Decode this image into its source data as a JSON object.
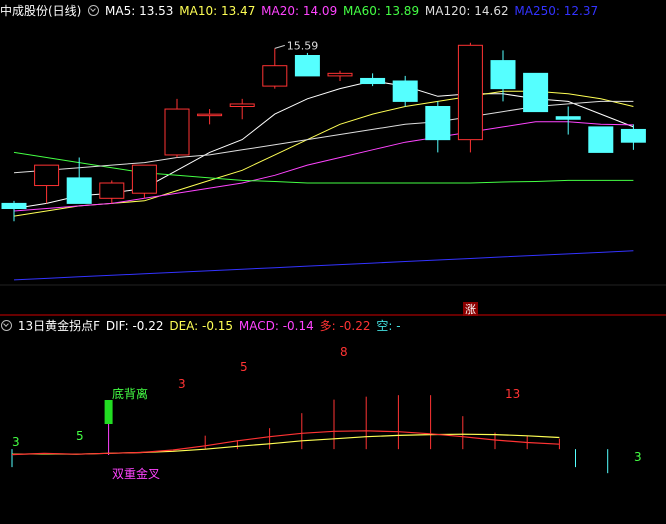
{
  "top_header": {
    "stock_name": "中成股份(日线)",
    "indicators": [
      {
        "label": "MA5: 13.53",
        "color": "#ffffff"
      },
      {
        "label": "MA10: 13.47",
        "color": "#ffff55"
      },
      {
        "label": "MA20: 14.09",
        "color": "#ff44ff"
      },
      {
        "label": "MA60: 13.89",
        "color": "#44ff44"
      },
      {
        "label": "MA120: 14.62",
        "color": "#dddddd"
      },
      {
        "label": "MA250: 12.37",
        "color": "#3333ff"
      }
    ]
  },
  "bottom_header": {
    "indicator_name": "13日黄金拐点F",
    "indicators": [
      {
        "label": "DIF: -0.22",
        "color": "#ffffff"
      },
      {
        "label": "DEA: -0.15",
        "color": "#ffff55"
      },
      {
        "label": "MACD: -0.14",
        "color": "#ff44ff"
      },
      {
        "label": "多: -0.22",
        "color": "#ff3333"
      },
      {
        "label": "空: -",
        "color": "#44dddd"
      }
    ]
  },
  "chart_data": [
    {
      "type": "candlestick",
      "high_label": "15.59",
      "marker": "涨",
      "candles": [
        {
          "o": 12.55,
          "h": 12.6,
          "l": 12.2,
          "c": 12.45
        },
        {
          "o": 12.9,
          "h": 13.15,
          "l": 12.55,
          "c": 13.3
        },
        {
          "o": 13.05,
          "h": 13.45,
          "l": 12.55,
          "c": 12.55
        },
        {
          "o": 12.65,
          "h": 13.0,
          "l": 12.55,
          "c": 12.95
        },
        {
          "o": 12.75,
          "h": 13.25,
          "l": 12.65,
          "c": 13.3
        },
        {
          "o": 13.5,
          "h": 14.6,
          "l": 13.45,
          "c": 14.4
        },
        {
          "o": 14.3,
          "h": 14.4,
          "l": 14.1,
          "c": 14.3
        },
        {
          "o": 14.45,
          "h": 14.6,
          "l": 14.2,
          "c": 14.5
        },
        {
          "o": 14.85,
          "h": 15.59,
          "l": 14.8,
          "c": 15.25
        },
        {
          "o": 15.45,
          "h": 15.5,
          "l": 15.05,
          "c": 15.05
        },
        {
          "o": 15.05,
          "h": 15.15,
          "l": 14.95,
          "c": 15.1
        },
        {
          "o": 15.0,
          "h": 15.1,
          "l": 14.85,
          "c": 14.9
        },
        {
          "o": 14.95,
          "h": 15.05,
          "l": 14.45,
          "c": 14.55
        },
        {
          "o": 14.45,
          "h": 14.55,
          "l": 13.55,
          "c": 13.8
        },
        {
          "o": 13.8,
          "h": 15.7,
          "l": 13.55,
          "c": 15.65
        },
        {
          "o": 15.35,
          "h": 15.55,
          "l": 14.55,
          "c": 14.8
        },
        {
          "o": 15.1,
          "h": 15.1,
          "l": 14.35,
          "c": 14.35
        },
        {
          "o": 14.25,
          "h": 14.45,
          "l": 13.9,
          "c": 14.2
        },
        {
          "o": 14.05,
          "h": 14.05,
          "l": 13.55,
          "c": 13.55
        },
        {
          "o": 14.0,
          "h": 14.1,
          "l": 13.6,
          "c": 13.75
        }
      ],
      "ma_series": [
        {
          "name": "MA5",
          "color": "#ffffff",
          "values": [
            12.45,
            12.55,
            12.7,
            12.75,
            12.85,
            13.2,
            13.55,
            13.8,
            14.3,
            14.6,
            14.8,
            14.95,
            14.85,
            14.65,
            14.7,
            14.7,
            14.6,
            14.55,
            14.3,
            14.05
          ]
        },
        {
          "name": "MA10",
          "color": "#ffff55",
          "values": [
            12.3,
            12.4,
            12.5,
            12.55,
            12.6,
            12.8,
            13.0,
            13.2,
            13.5,
            13.8,
            14.1,
            14.3,
            14.45,
            14.55,
            14.65,
            14.75,
            14.75,
            14.7,
            14.6,
            14.45
          ]
        },
        {
          "name": "MA20",
          "color": "#ff44ff",
          "values": [
            12.4,
            12.45,
            12.5,
            12.55,
            12.65,
            12.75,
            12.85,
            12.95,
            13.1,
            13.3,
            13.45,
            13.6,
            13.75,
            13.85,
            13.95,
            14.05,
            14.15,
            14.15,
            14.1,
            14.09
          ]
        },
        {
          "name": "MA60",
          "color": "#44ff44",
          "values": [
            13.55,
            13.45,
            13.35,
            13.25,
            13.15,
            13.1,
            13.05,
            13.0,
            12.98,
            12.95,
            12.95,
            12.95,
            12.95,
            12.95,
            12.95,
            12.97,
            12.98,
            13.0,
            13.0,
            13.0
          ]
        },
        {
          "name": "MA120",
          "color": "#dddddd",
          "values": [
            13.15,
            13.2,
            13.25,
            13.3,
            13.35,
            13.45,
            13.5,
            13.6,
            13.7,
            13.8,
            13.9,
            14.0,
            14.1,
            14.15,
            14.25,
            14.35,
            14.45,
            14.5,
            14.55,
            14.55
          ]
        },
        {
          "name": "MA250",
          "color": "#3333ff",
          "values": [
            11.05,
            11.08,
            11.11,
            11.14,
            11.17,
            11.2,
            11.23,
            11.26,
            11.29,
            11.32,
            11.35,
            11.38,
            11.41,
            11.44,
            11.47,
            11.5,
            11.53,
            11.56,
            11.59,
            11.62
          ]
        }
      ]
    },
    {
      "type": "line",
      "note": "13日黄金拐点F indicator panel",
      "dif": [
        -0.63,
        -0.6,
        -0.62,
        -0.6,
        -0.58,
        -0.52,
        -0.42,
        -0.3,
        -0.2,
        -0.12,
        -0.07,
        -0.06,
        -0.08,
        -0.13,
        -0.2,
        -0.28,
        -0.34,
        -0.38
      ],
      "dea": [
        -0.62,
        -0.61,
        -0.62,
        -0.6,
        -0.58,
        -0.55,
        -0.5,
        -0.43,
        -0.37,
        -0.3,
        -0.25,
        -0.2,
        -0.17,
        -0.15,
        -0.14,
        -0.15,
        -0.18,
        -0.22
      ],
      "red_bars": [
        {
          "x": 6,
          "h": 0.45
        },
        {
          "x": 7,
          "h": 0.3
        },
        {
          "x": 8,
          "h": 0.7
        },
        {
          "x": 9,
          "h": 1.2
        },
        {
          "x": 10,
          "h": 1.65
        },
        {
          "x": 11,
          "h": 1.75
        },
        {
          "x": 12,
          "h": 1.8
        },
        {
          "x": 13,
          "h": 1.8
        },
        {
          "x": 14,
          "h": 1.1
        },
        {
          "x": 15,
          "h": 0.55
        },
        {
          "x": 16,
          "h": 0.45
        },
        {
          "x": 17,
          "h": 0.35
        }
      ],
      "cyan_bars": [
        {
          "x": 0,
          "h": -0.3
        },
        {
          "x": 17.5,
          "h": -0.3
        },
        {
          "x": 18.5,
          "h": -0.4
        }
      ],
      "annotations": [
        {
          "text": "底背离",
          "color": "#44ff44"
        },
        {
          "text": "双重金叉",
          "color": "#ff44ff"
        },
        {
          "text": "3",
          "color": "#ff3333"
        },
        {
          "text": "5",
          "color": "#ff3333"
        },
        {
          "text": "8",
          "color": "#ff3333"
        },
        {
          "text": "13",
          "color": "#ff3333"
        },
        {
          "text": "5",
          "color": "#44ff44"
        },
        {
          "text": "3",
          "color": "#44ff44"
        },
        {
          "text": "3",
          "color": "#44ff44"
        }
      ]
    }
  ]
}
